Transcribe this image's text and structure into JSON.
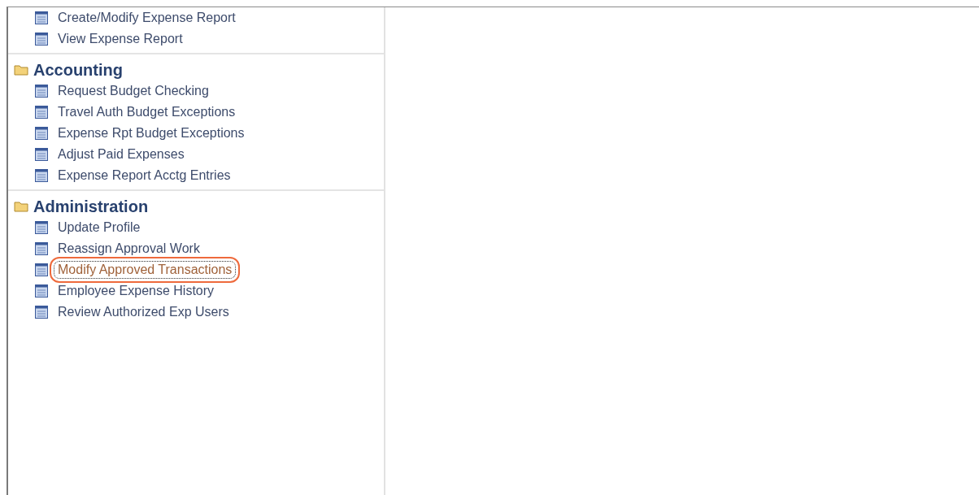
{
  "sections": [
    {
      "items": [
        {
          "label": "Create/Modify Expense Report",
          "selected": false
        },
        {
          "label": "View Expense Report",
          "selected": false
        }
      ]
    },
    {
      "title": "Accounting",
      "items": [
        {
          "label": "Request Budget Checking",
          "selected": false
        },
        {
          "label": "Travel Auth Budget Exceptions",
          "selected": false
        },
        {
          "label": "Expense Rpt Budget Exceptions",
          "selected": false
        },
        {
          "label": "Adjust Paid Expenses",
          "selected": false
        },
        {
          "label": "Expense Report Acctg Entries",
          "selected": false
        }
      ]
    },
    {
      "title": "Administration",
      "items": [
        {
          "label": "Update Profile",
          "selected": false
        },
        {
          "label": "Reassign Approval Work",
          "selected": false
        },
        {
          "label": "Modify Approved Transactions",
          "selected": true
        },
        {
          "label": "Employee Expense History",
          "selected": false
        },
        {
          "label": "Review Authorized Exp Users",
          "selected": false
        }
      ]
    }
  ]
}
